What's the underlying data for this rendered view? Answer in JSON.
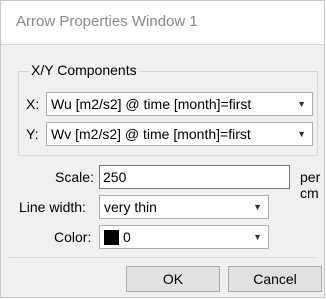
{
  "window": {
    "title": "Arrow Properties Window 1"
  },
  "xy_group": {
    "label": "X/Y Components",
    "x_label": "X:",
    "x_value": "Wu [m2/s2] @ time [month]=first",
    "y_label": "Y:",
    "y_value": "Wv [m2/s2] @ time [month]=first"
  },
  "scale": {
    "label": "Scale:",
    "value": "250",
    "unit": "per cm"
  },
  "line_width": {
    "label": "Line width:",
    "value": "very thin"
  },
  "color": {
    "label": "Color:",
    "value": "0",
    "swatch_color": "#000000"
  },
  "buttons": {
    "ok": "OK",
    "cancel": "Cancel"
  },
  "icons": {
    "dropdown": "▼"
  }
}
